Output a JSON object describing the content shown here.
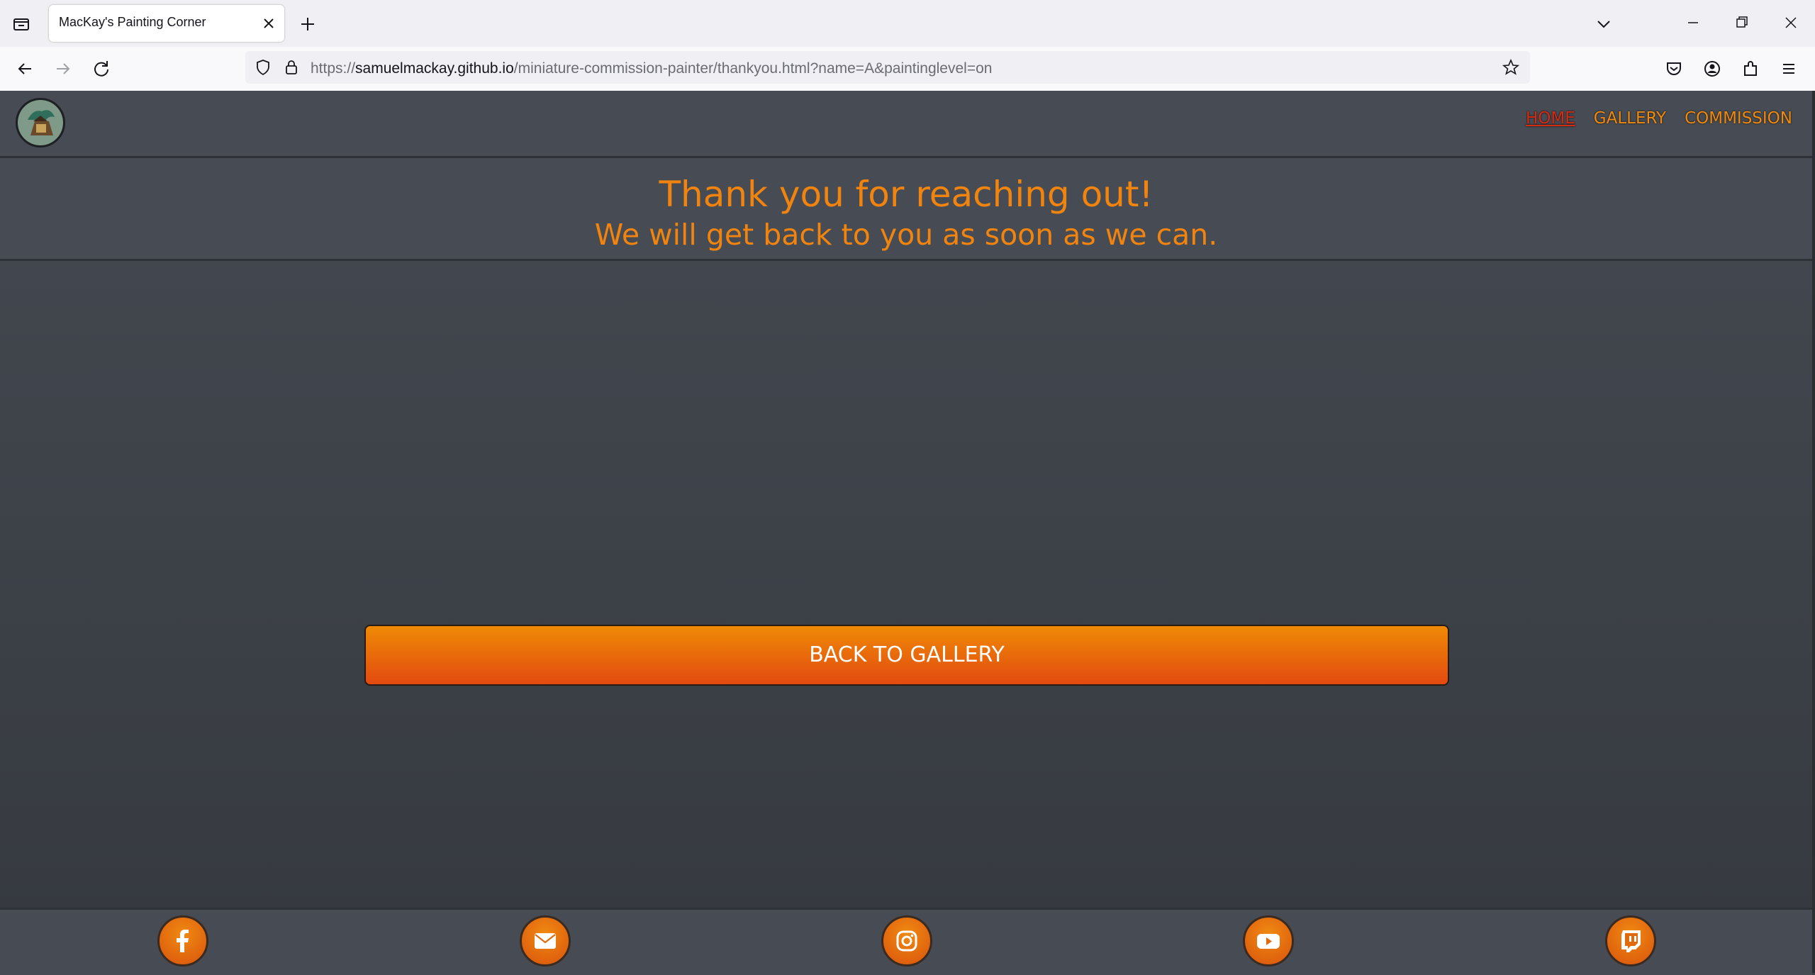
{
  "browser": {
    "tab_title": "MacKay's Painting Corner",
    "url_scheme": "https://",
    "url_host": "samuelmackay.github.io",
    "url_path": "/miniature-commission-painter/thankyou.html?name=A&paintinglevel=on"
  },
  "site": {
    "nav": [
      {
        "label": "HOME",
        "active": true
      },
      {
        "label": "GALLERY",
        "active": false
      },
      {
        "label": "COMMISSION",
        "active": false
      }
    ],
    "thanks_title": "Thank you for reaching out!",
    "thanks_subtitle": "We will get back to you as soon as we can.",
    "back_button": "BACK TO GALLERY",
    "social_icons": [
      "facebook-icon",
      "email-icon",
      "instagram-icon",
      "youtube-icon",
      "twitch-icon"
    ]
  },
  "colors": {
    "accent": "#f0840e",
    "active_nav": "#d42b12",
    "button_top": "#ef8a06",
    "button_bottom": "#e24a10",
    "panel": "#474c54"
  }
}
